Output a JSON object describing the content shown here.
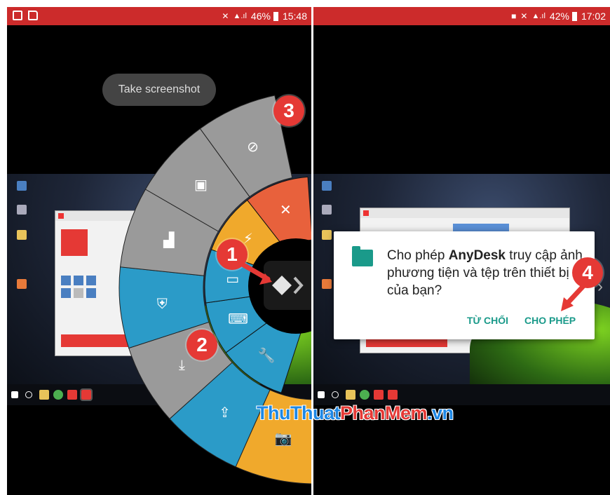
{
  "left_panel": {
    "status_bar": {
      "battery": "46%",
      "time": "15:48"
    },
    "toast": "Take screenshot",
    "radial_menu": {
      "outer_items": [
        {
          "icon": "camera-icon",
          "color": "#f0a92c"
        },
        {
          "icon": "upload-icon",
          "color": "#2b9bc8"
        },
        {
          "icon": "download-icon",
          "color": "#9a9a9a"
        },
        {
          "icon": "shield-icon",
          "color": "#2b9bc8"
        },
        {
          "icon": "block-icon",
          "color": "#9a9a9a"
        },
        {
          "icon": "monitor-lock-icon",
          "color": "#9a9a9a"
        },
        {
          "icon": "monitor-hide-icon",
          "color": "#9a9a9a"
        }
      ],
      "inner_items": [
        {
          "icon": "wrench-icon",
          "color": "#2b9bc8"
        },
        {
          "icon": "keyboard-mouse-icon",
          "color": "#2b9bc8"
        },
        {
          "icon": "monitor-icon",
          "color": "#2b9bc8"
        },
        {
          "icon": "lightning-icon",
          "color": "#f0a92c"
        },
        {
          "icon": "close-icon",
          "color": "#e8613c"
        }
      ]
    },
    "badges": [
      "1",
      "2",
      "3"
    ]
  },
  "right_panel": {
    "status_bar": {
      "battery": "42%",
      "time": "17:02"
    },
    "dialog": {
      "message_prefix": "Cho phép ",
      "app_name": "AnyDesk",
      "message_rest": " truy cập ảnh, phương tiện và tệp trên thiết bị của bạn?",
      "deny_button": "TỪ CHỐI",
      "allow_button": "CHO PHÉP",
      "accent_color": "#1a9a8a"
    },
    "badges": [
      "4"
    ]
  },
  "watermark": {
    "part1": "ThuThuat",
    "part2": "PhanMem",
    "part3": ".vn"
  }
}
